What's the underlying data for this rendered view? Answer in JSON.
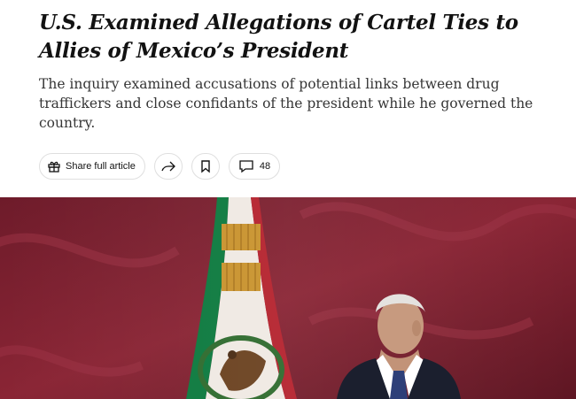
{
  "article": {
    "headline": "U.S. Examined Allegations of Cartel Ties to Allies of Mexico’s President",
    "summary": "The inquiry examined accusations of potential links between drug traffickers and close confidants of the president while he governed the country."
  },
  "toolbar": {
    "share_label": "Share full article",
    "share_icon": "gift-icon",
    "forward_icon": "share-arrow-icon",
    "save_icon": "bookmark-icon",
    "comments_icon": "comment-bubble-icon",
    "comments_count": "48"
  },
  "colors": {
    "headline": "#121212",
    "summary": "#363636",
    "photo_background": "#7a2030",
    "flag_green": "#0d7a3f",
    "flag_red": "#b5232e"
  }
}
